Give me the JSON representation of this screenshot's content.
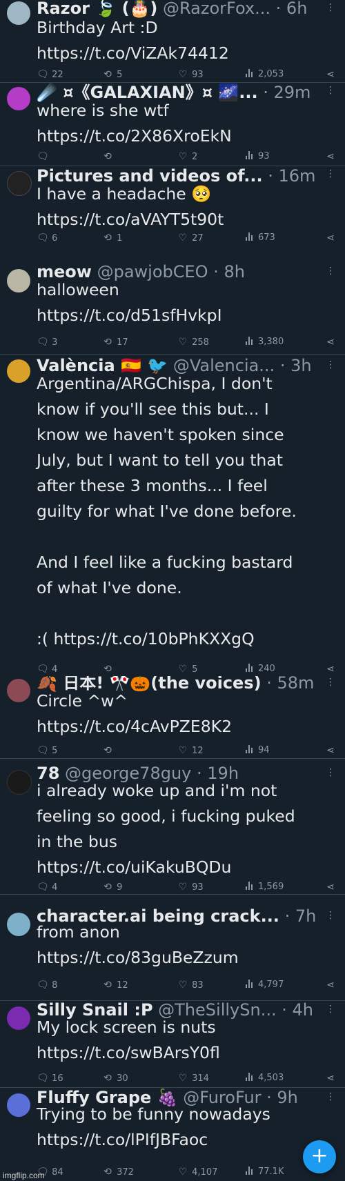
{
  "tweets": [
    {
      "name": "Razor 🍃 (🎂)",
      "handle": "@RazorFox...",
      "time": "· 6h",
      "text": "Birthday Art :D\nhttps://t.co/ViZAk74412",
      "replies": "22",
      "retweets": "5",
      "likes": "93",
      "views": "2,053",
      "avatar_color": "#9fb7c4"
    },
    {
      "name": "☄️ ¤《GALAXIAN》¤ 🌌...",
      "handle": "",
      "time": "· 29m",
      "text": "where is she wtf\nhttps://t.co/2X86XroEkN",
      "replies": "",
      "retweets": "",
      "likes": "2",
      "views": "93",
      "avatar_color": "#b43cc7"
    },
    {
      "name": "Pictures and videos of...",
      "handle": "",
      "time": "· 16m",
      "text": "I have a headache 🥺\nhttps://t.co/aVAYT5t90t",
      "replies": "6",
      "retweets": "1",
      "likes": "27",
      "views": "673",
      "avatar_color": "#222222"
    },
    {
      "name": "meow",
      "handle": "@pawjobCEO",
      "time": "· 8h",
      "text": "halloween\nhttps://t.co/d51sfHvkpI",
      "replies": "3",
      "retweets": "17",
      "likes": "258",
      "views": "3,380",
      "avatar_color": "#b9b6a6"
    },
    {
      "name": "València 🇪🇸 🐦",
      "handle": "@Valencia...",
      "time": "· 3h",
      "text": "Argentina/ARGChispa, I don't\nknow if you'll see this but... I\nknow we haven't spoken since\nJuly, but I want to tell you that\nafter these 3 months... I feel\nguilty for what I've done before.\n\nAnd I feel like a fucking bastard\nof what I've done.\n\n:( https://t.co/10bPhKXXgQ",
      "replies": "4",
      "retweets": "",
      "likes": "5",
      "views": "240",
      "avatar_color": "#d9a129"
    },
    {
      "name": "🍂 日本! 🎌🎃(the voices)",
      "handle": "",
      "time": "· 58m",
      "text": "Circle ^w^\nhttps://t.co/4cAvPZE8K2",
      "replies": "5",
      "retweets": "",
      "likes": "12",
      "views": "94",
      "avatar_color": "#8c4a55"
    },
    {
      "name": "78",
      "handle": "@george78guy",
      "time": "· 19h",
      "text": "i already woke up and i'm not\nfeeling so good, i fucking puked\nin the bus\nhttps://t.co/uiKakuBQDu",
      "replies": "4",
      "retweets": "9",
      "likes": "93",
      "views": "1,569",
      "avatar_color": "#1a1a1a"
    },
    {
      "name": "character.ai being crack...",
      "handle": "",
      "time": "· 7h",
      "text": "from anon\nhttps://t.co/83guBeZzum",
      "replies": "8",
      "retweets": "12",
      "likes": "83",
      "views": "4,797",
      "avatar_color": "#7fb0c9"
    },
    {
      "name": "Silly Snail :P",
      "handle": "@TheSillySn...",
      "time": "· 4h",
      "text": "My lock screen is nuts\nhttps://t.co/swBArsY0fl",
      "replies": "16",
      "retweets": "30",
      "likes": "314",
      "views": "4,503",
      "avatar_color": "#7a2bb0"
    },
    {
      "name": "Fluffy Grape 🍇",
      "handle": "@FuroFur",
      "time": "· 9h",
      "text": "Trying to be funny nowadays\nhttps://t.co/lPIfJBFaoc",
      "replies": "84",
      "retweets": "372",
      "likes": "4,107",
      "views": "77.1K",
      "avatar_color": "#5b6fd8"
    }
  ],
  "fab": {
    "label": "+"
  },
  "watermark": "imgflip.com",
  "colors": {
    "background": "#15202b",
    "accent": "#1d9bf0",
    "muted": "#8b98a5"
  }
}
